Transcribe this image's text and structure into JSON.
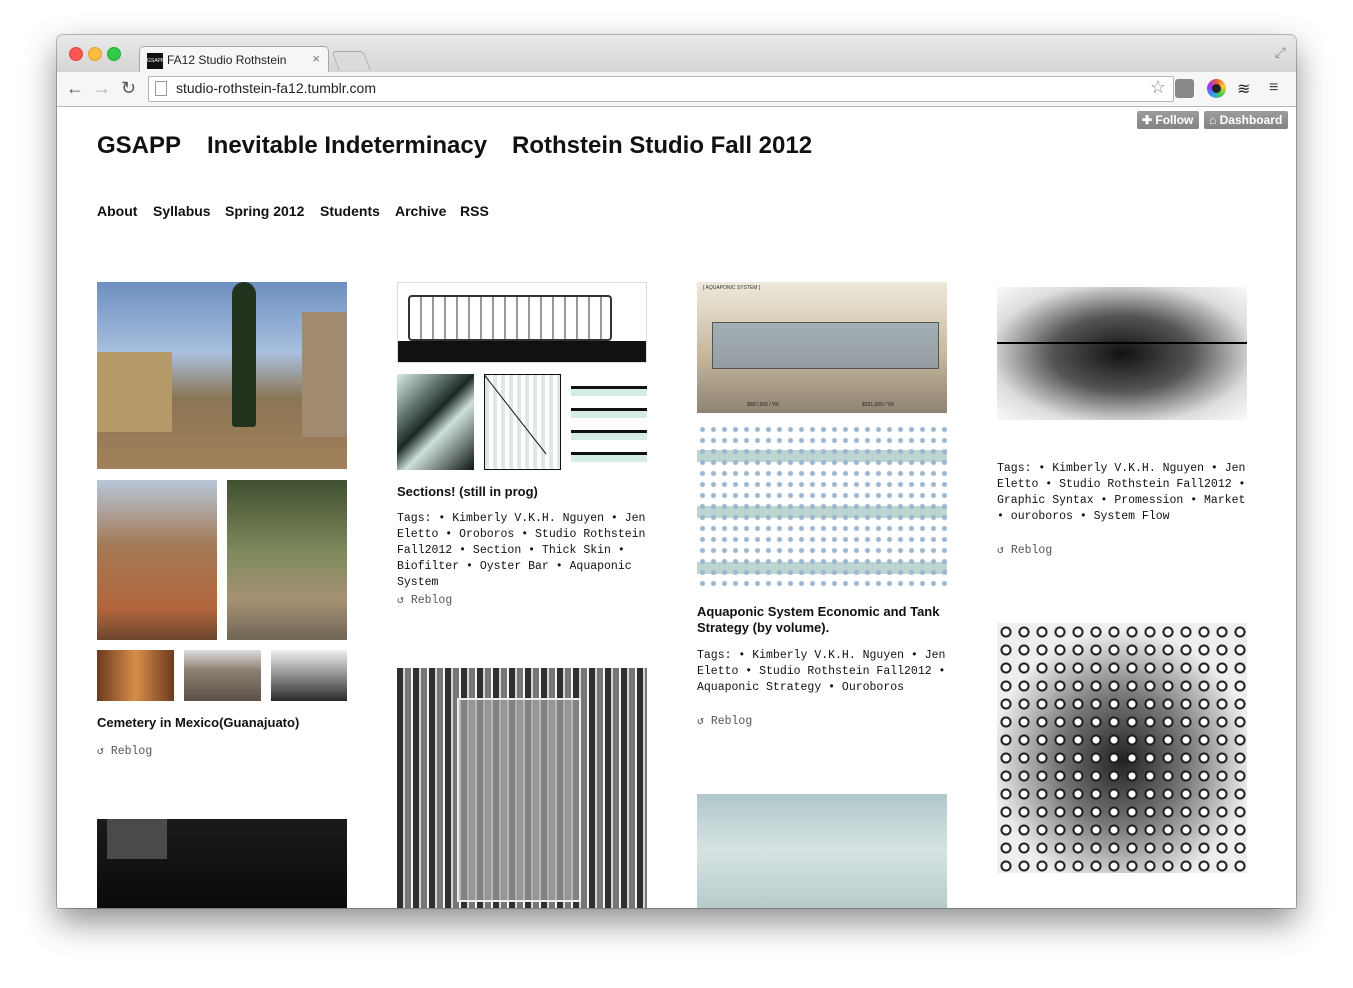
{
  "browser": {
    "tab_title": "FA12 Studio Rothstein",
    "favicon_text": "GSAPP",
    "url": "studio-rothstein-fa12.tumblr.com"
  },
  "tumblr": {
    "follow_label": "Follow",
    "dashboard_label": "Dashboard"
  },
  "header": {
    "titles": [
      "GSAPP",
      "Inevitable Indeterminacy",
      "Rothstein Studio Fall 2012"
    ]
  },
  "nav": [
    "About",
    "Syllabus",
    "Spring 2012",
    "Students",
    "Archive",
    "RSS"
  ],
  "posts": {
    "cemetery": {
      "caption": "Cemetery in Mexico(Guanajuato)",
      "reblog": "Reblog"
    },
    "sections": {
      "caption": "Sections! (still in prog)",
      "tags": "Tags: • Kimberly V.K.H. Nguyen • Jen Eletto • Oroboros • Studio Rothstein Fall2012 • Section • Thick Skin • Biofilter • Oyster Bar • Aquaponic System",
      "reblog": "Reblog"
    },
    "aquaponic": {
      "caption": "Aquaponic System Economic and Tank Strategy (by volume).",
      "tags": "Tags: • Kimberly V.K.H. Nguyen • Jen Eletto • Studio Rothstein Fall2012 • Aquaponic Strategy • Ouroboros",
      "reblog": "Reblog",
      "diagram_labels": [
        "[ AQUAPONIC SYSTEM ]",
        "$607,500 / YR",
        "$391,000 / YR"
      ]
    },
    "flow": {
      "tags": "Tags: • Kimberly V.K.H. Nguyen • Jen Eletto • Studio Rothstein Fall2012 • Graphic Syntax • Promession • Market • ouroboros • System Flow",
      "reblog": "Reblog"
    }
  },
  "colors": {
    "traffic_red": "#fc5753",
    "traffic_yellow": "#fdbc40",
    "traffic_green": "#34c84a",
    "tumblr_button": "#8f8f8f"
  }
}
